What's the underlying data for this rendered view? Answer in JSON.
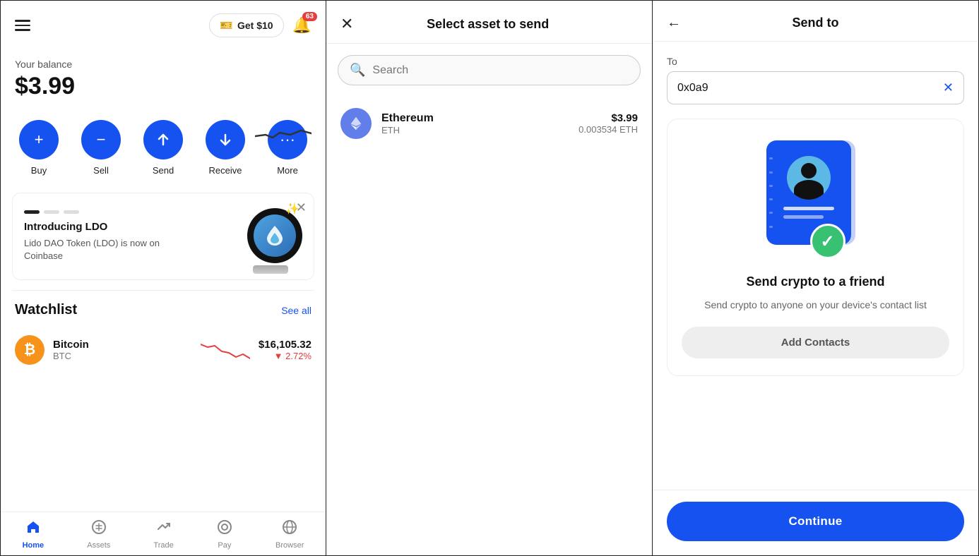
{
  "panel1": {
    "header": {
      "get_money_label": "Get $10",
      "notification_count": "63"
    },
    "balance": {
      "label": "Your balance",
      "amount": "$3.99"
    },
    "actions": [
      {
        "label": "Buy",
        "icon": "+"
      },
      {
        "label": "Sell",
        "icon": "−"
      },
      {
        "label": "Send",
        "icon": "↑"
      },
      {
        "label": "Receive",
        "icon": "↓"
      },
      {
        "label": "More",
        "icon": "···"
      }
    ],
    "promo": {
      "title": "Introducing LDO",
      "description": "Lido DAO Token (LDO) is now on Coinbase"
    },
    "watchlist": {
      "title": "Watchlist",
      "see_all": "See all",
      "items": [
        {
          "name": "Bitcoin",
          "ticker": "BTC",
          "price": "$16,105.32",
          "change": "▼ 2.72%"
        }
      ]
    },
    "nav": [
      {
        "label": "Home",
        "active": true
      },
      {
        "label": "Assets",
        "active": false
      },
      {
        "label": "Trade",
        "active": false
      },
      {
        "label": "Pay",
        "active": false
      },
      {
        "label": "Browser",
        "active": false
      }
    ]
  },
  "panel2": {
    "title": "Select asset to send",
    "search_placeholder": "Search",
    "assets": [
      {
        "name": "Ethereum",
        "ticker": "ETH",
        "usd_value": "$3.99",
        "crypto_amount": "0.003534 ETH"
      }
    ]
  },
  "panel3": {
    "title": "Send to",
    "to_label": "To",
    "to_value": "0x0a9",
    "card": {
      "title": "Send crypto to a friend",
      "description": "Send crypto to anyone on your device's contact list",
      "add_contacts_label": "Add Contacts"
    },
    "continue_label": "Continue"
  }
}
